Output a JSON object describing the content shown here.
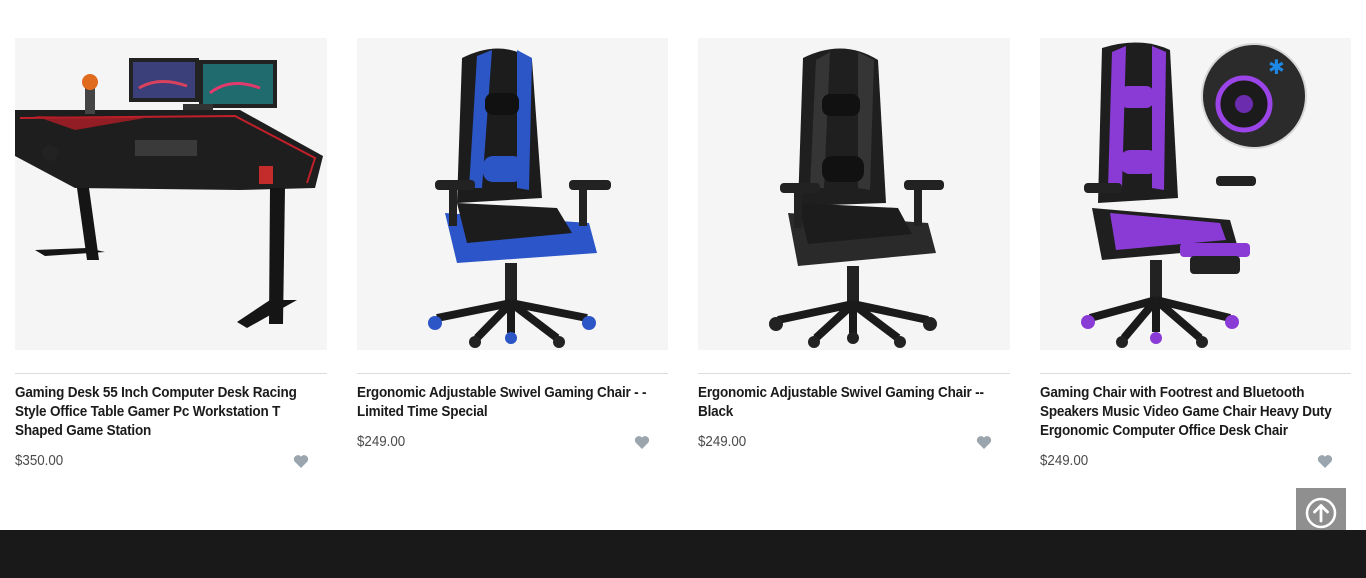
{
  "products": [
    {
      "title": "Gaming Desk 55 Inch Computer Desk Racing Style Office Table Gamer Pc Workstation T Shaped Game Station",
      "price": "$350.00",
      "image": "gaming-desk-image"
    },
    {
      "title": "Ergonomic Adjustable Swivel Gaming Chair - - Limited Time Special",
      "price": "$249.00",
      "image": "blue-gaming-chair-image"
    },
    {
      "title": "Ergonomic Adjustable Swivel Gaming Chair -- Black",
      "price": "$249.00",
      "image": "black-gaming-chair-image"
    },
    {
      "title": "Gaming Chair with Footrest and Bluetooth Speakers Music Video Game Chair Heavy Duty Ergonomic Computer Office Desk Chair",
      "price": "$249.00",
      "image": "purple-gaming-chair-image"
    }
  ],
  "icons": {
    "wishlist": "heart-icon",
    "back_to_top": "arrow-up-circle-icon"
  },
  "colors": {
    "footer": "#1a1919",
    "wishlist": "#9aa5ad",
    "back_to_top_bg": "#8f8f8f"
  }
}
